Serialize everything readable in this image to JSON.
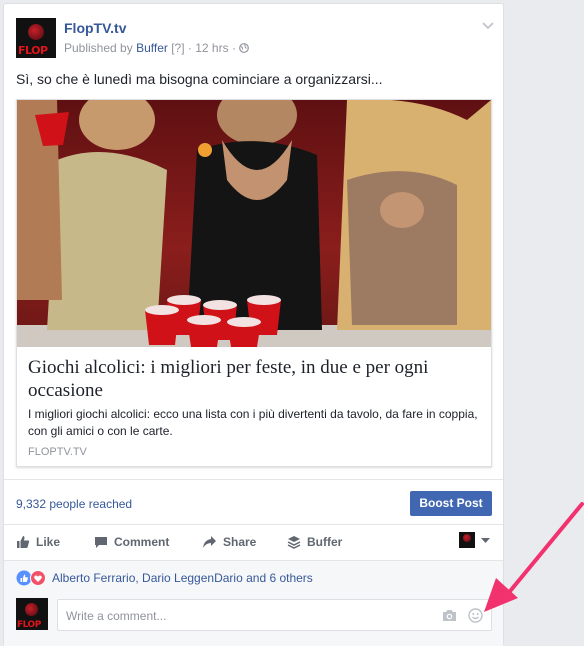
{
  "post": {
    "page_name": "FlopTV.tv",
    "published_by_prefix": "Published by",
    "publisher": "Buffer",
    "help_marker": "[?]",
    "separator": "·",
    "time": "12 hrs",
    "text": "Sì, so che è lunedì ma bisogna cominciare a organizzarsi...",
    "avatar_logo_text": "FLOP"
  },
  "link_preview": {
    "headline": "Giochi alcolici: i migliori per feste, in due e per ogni occasione",
    "description": "I migliori giochi alcolici: ecco una lista con i più divertenti da tavolo, da fare in coppia, con gli amici o con le carte.",
    "domain": "FLOPTV.TV"
  },
  "insights": {
    "reach": "9,332 people reached",
    "boost_label": "Boost Post"
  },
  "actions": {
    "like": "Like",
    "comment": "Comment",
    "share": "Share",
    "buffer": "Buffer"
  },
  "reactions": {
    "summary": "Alberto Ferrario, Dario LeggenDario and 6 others"
  },
  "comment": {
    "placeholder": "Write a comment..."
  },
  "colors": {
    "link_blue": "#365899",
    "boost_blue": "#4267b2",
    "annotation_arrow": "#f2326e"
  },
  "icons": {
    "chevron": "chevron-down-icon",
    "globe": "globe-icon",
    "like": "thumbs-up-icon",
    "comment": "speech-bubble-icon",
    "share": "share-arrow-icon",
    "buffer": "buffer-stack-icon",
    "camera": "camera-icon",
    "emoji": "smiley-icon"
  }
}
